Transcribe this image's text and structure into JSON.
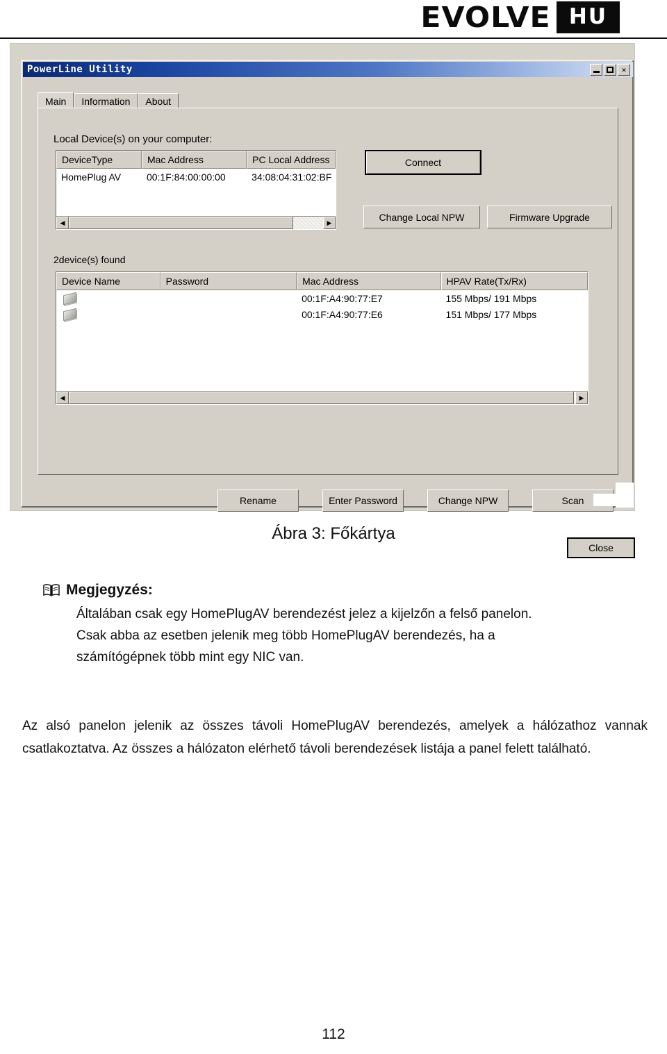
{
  "header": {
    "brand": "EVOLVE",
    "locale_badge": "HU"
  },
  "window": {
    "title": "PowerLine Utility",
    "controls": {
      "minimize": "–",
      "maximize": "□",
      "close": "✕"
    },
    "tabs": [
      {
        "label": "Main",
        "active": true
      },
      {
        "label": "Information",
        "active": false
      },
      {
        "label": "About",
        "active": false
      }
    ],
    "local_section": {
      "label": "Local Device(s) on your computer:",
      "columns": [
        "DeviceType",
        "Mac Address",
        "PC Local Address"
      ],
      "rows": [
        {
          "device_type": "HomePlug AV",
          "mac_address": "00:1F:84:00:00:00",
          "pc_local_address": "34:08:04:31:02:BF"
        }
      ]
    },
    "local_buttons": {
      "connect": "Connect",
      "change_local_npw": "Change Local NPW",
      "firmware_upgrade": "Firmware Upgrade"
    },
    "remote_section": {
      "status": "2device(s) found",
      "columns": [
        "Device Name",
        "Password",
        "Mac Address",
        "HPAV Rate(Tx/Rx)"
      ],
      "rows": [
        {
          "device_name": "",
          "password": "",
          "mac_address": "00:1F:A4:90:77:E7",
          "hpav_rate": "155 Mbps/ 191 Mbps"
        },
        {
          "device_name": "",
          "password": "",
          "mac_address": "00:1F:A4:90:77:E6",
          "hpav_rate": "151 Mbps/ 177 Mbps"
        }
      ]
    },
    "remote_buttons": {
      "rename": "Rename",
      "enter_password": "Enter Password",
      "change_npw": "Change NPW",
      "scan": "Scan"
    },
    "close_button": "Close",
    "scroll_arrows": {
      "left": "◀",
      "right": "▶"
    }
  },
  "figure_caption": "Ábra 3: Főkártya",
  "note": {
    "icon": "book-icon",
    "title": "Megjegyzés:",
    "lines": [
      "Általában csak egy HomePlugAV berendezést jelez a kijelzőn a felső panelon.",
      "Csak abba az esetben jelenik meg több HomePlugAV berendezés, ha a",
      "számítógépnek több mint egy NIC van."
    ]
  },
  "paragraph": "Az alsó panelon jelenik az összes távoli HomePlugAV berendezés, amelyek a hálózathoz vannak csatlakoztatva. Az összes a hálózaton elérhető távoli berendezések listája a panel felett található.",
  "page_number": "112",
  "colors": {
    "titlebar_start": "#0b2a73",
    "titlebar_end": "#d9e3f4",
    "window_face": "#d4d0c8",
    "brand_black": "#0b0b0b"
  }
}
